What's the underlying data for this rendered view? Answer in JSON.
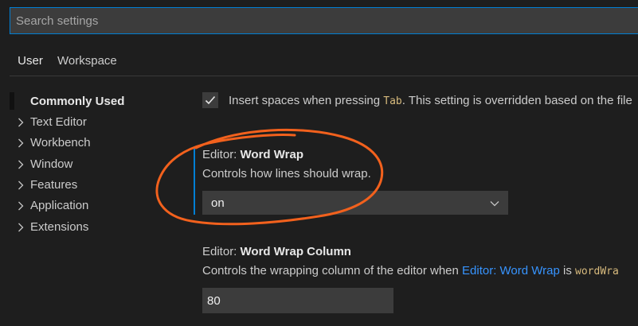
{
  "search": {
    "placeholder": "Search settings",
    "value": ""
  },
  "tabs": [
    {
      "label": "User",
      "active": true
    },
    {
      "label": "Workspace",
      "active": false
    }
  ],
  "toc": [
    {
      "label": "Commonly Used",
      "current": true,
      "expandable": false
    },
    {
      "label": "Text Editor",
      "current": false,
      "expandable": true
    },
    {
      "label": "Workbench",
      "current": false,
      "expandable": true
    },
    {
      "label": "Window",
      "current": false,
      "expandable": true
    },
    {
      "label": "Features",
      "current": false,
      "expandable": true
    },
    {
      "label": "Application",
      "current": false,
      "expandable": true
    },
    {
      "label": "Extensions",
      "current": false,
      "expandable": true
    }
  ],
  "settings": {
    "insert_spaces": {
      "checked": true,
      "desc_before": "Insert spaces when pressing ",
      "desc_code": "Tab",
      "desc_after": ". This setting is overridden based on the file"
    },
    "word_wrap": {
      "category": "Editor: ",
      "name": "Word Wrap",
      "description": "Controls how lines should wrap.",
      "value": "on"
    },
    "word_wrap_column": {
      "category": "Editor: ",
      "name": "Word Wrap Column",
      "desc_before": "Controls the wrapping column of the editor when ",
      "desc_link": "Editor: Word Wrap",
      "desc_middle": " is ",
      "desc_code": "wordWra",
      "value": "80"
    }
  },
  "icons": {
    "chevron_right": "chevron-right-icon",
    "chevron_down": "chevron-down-icon",
    "check": "check-icon"
  },
  "colors": {
    "background": "#1e1e1e",
    "input_background": "#3c3c3c",
    "focus_border": "#007fd4",
    "link": "#3794ff",
    "code": "#d7ba7d",
    "annotation": "#f2611d"
  }
}
